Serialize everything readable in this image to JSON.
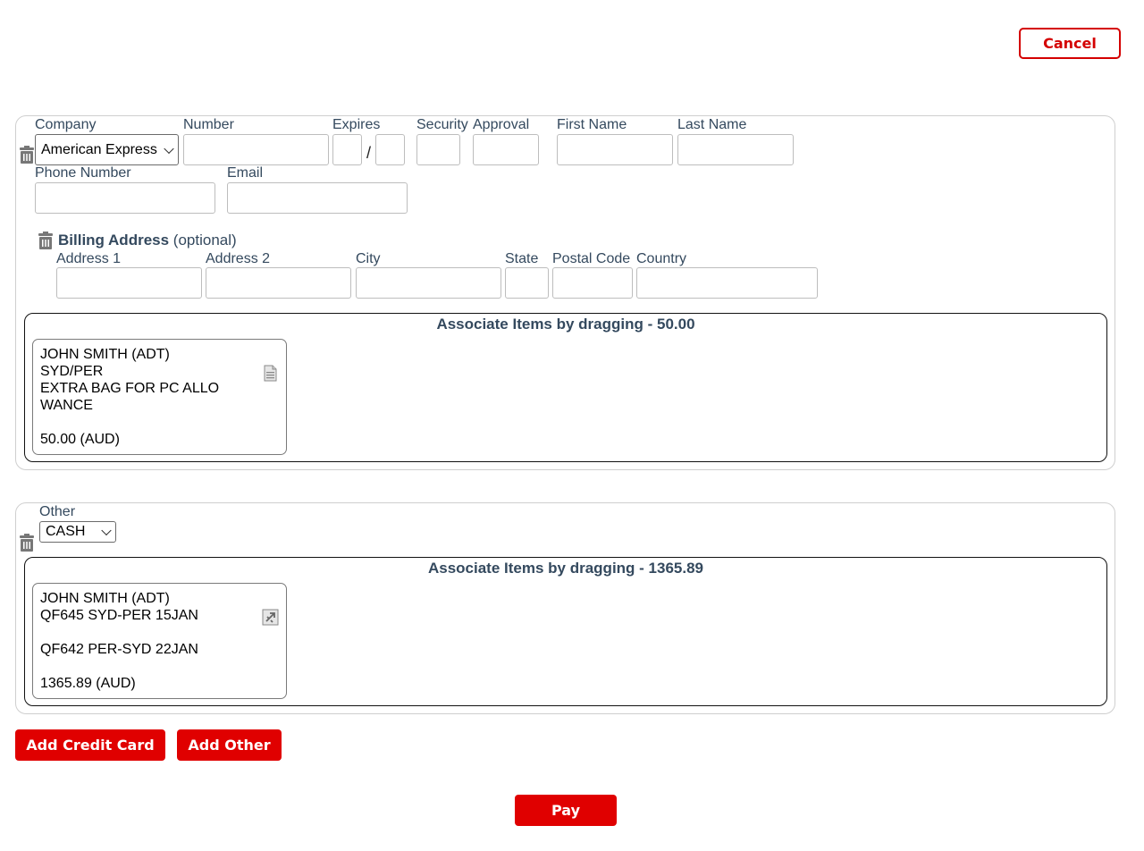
{
  "header": {
    "cancel_label": "Cancel"
  },
  "credit_card": {
    "labels": {
      "company": "Company",
      "number": "Number",
      "expires": "Expires",
      "security": "Security",
      "approval": "Approval",
      "first_name": "First Name",
      "last_name": "Last Name",
      "phone": "Phone Number",
      "email": "Email"
    },
    "company_value": "American Express",
    "expires_separator": "/",
    "values": {
      "number": "",
      "exp_month": "",
      "exp_year": "",
      "security": "",
      "approval": "",
      "first_name": "",
      "last_name": "",
      "phone": "",
      "email": ""
    },
    "billing": {
      "title": "Billing Address",
      "optional": "(optional)",
      "labels": {
        "address1": "Address 1",
        "address2": "Address 2",
        "city": "City",
        "state": "State",
        "postal": "Postal Code",
        "country": "Country"
      }
    },
    "associate_title": "Associate Items by dragging - 50.00",
    "items": [
      {
        "lines": [
          "JOHN SMITH (ADT)",
          "SYD/PER",
          "EXTRA BAG FOR PC ALLO",
          "WANCE",
          "",
          "50.00 (AUD)"
        ],
        "icon": "document-icon"
      }
    ]
  },
  "other": {
    "label": "Other",
    "value": "CASH",
    "associate_title": "Associate Items by dragging - 1365.89",
    "items": [
      {
        "lines": [
          "JOHN SMITH (ADT)",
          "QF645 SYD-PER 15JAN",
          "",
          "QF642 PER-SYD 22JAN",
          "",
          "1365.89 (AUD)"
        ],
        "icon": "flight-icon"
      }
    ]
  },
  "actions": {
    "add_credit_card": "Add Credit Card",
    "add_other": "Add Other",
    "pay": "Pay"
  },
  "colors": {
    "accent": "#e00000",
    "label": "#34495e"
  }
}
